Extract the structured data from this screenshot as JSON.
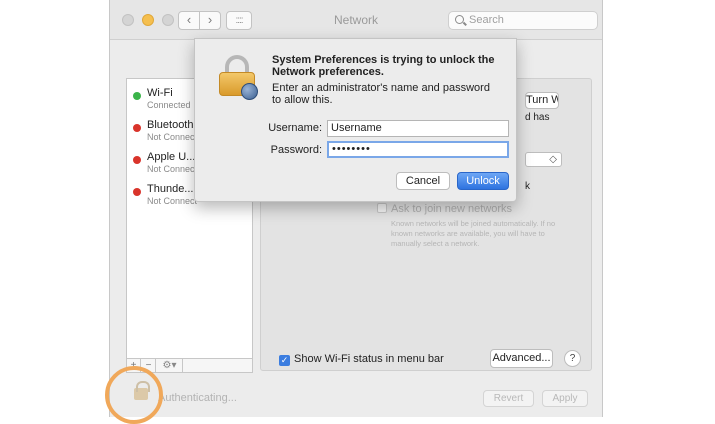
{
  "window": {
    "title": "Network",
    "search_placeholder": "Search",
    "nav_back": "‹",
    "nav_forward": "›",
    "grid_icon": "::::"
  },
  "sidebar": {
    "services": [
      {
        "name": "Wi-Fi",
        "status": "Connected",
        "color": "#3bb44a"
      },
      {
        "name": "Bluetooth P",
        "status": "Not Connect",
        "color": "#d9342b"
      },
      {
        "name": "Apple U...A",
        "status": "Not Connect",
        "color": "#d9342b"
      },
      {
        "name": "Thunde...lt",
        "status": "Not Connect",
        "color": "#d9342b"
      }
    ],
    "add_label": "+",
    "remove_label": "−",
    "gear_label": "⚙▾"
  },
  "panel": {
    "wifi_off_label": "Turn Wi-Fi Off",
    "fragment_has": "d has",
    "network_select_arrow": "◇",
    "fragment_k": "k",
    "ask_join_label": "Ask to join new networks",
    "ask_join_desc": "Known networks will be joined automatically. If no known networks are available, you will have to manually select a network.",
    "show_wifi_label": "Show Wi-Fi status in menu bar",
    "advanced_label": "Advanced...",
    "help_label": "?"
  },
  "footer": {
    "auth_text": "Authenticating...",
    "revert_label": "Revert",
    "apply_label": "Apply"
  },
  "dialog": {
    "title": "System Preferences is trying to unlock the Network preferences.",
    "message": "Enter an administrator's name and password to allow this.",
    "username_label": "Username:",
    "username_value": "Username",
    "password_label": "Password:",
    "password_value": "••••••••",
    "cancel_label": "Cancel",
    "unlock_label": "Unlock"
  },
  "colors": {
    "accent": "#3b7de0",
    "highlight": "#f0a85a",
    "connected": "#3bb44a",
    "disconnected": "#d9342b"
  }
}
